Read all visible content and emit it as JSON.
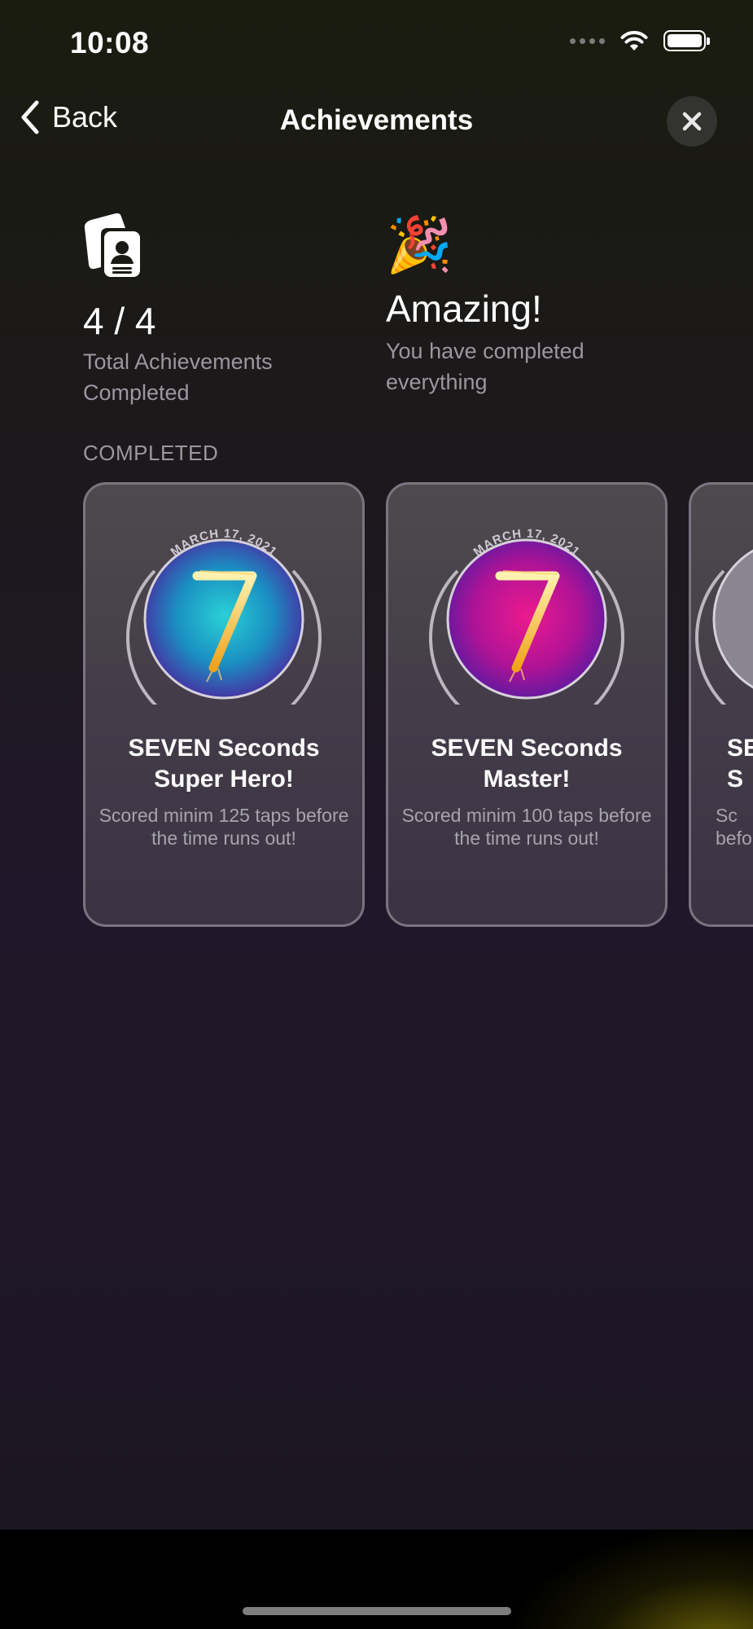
{
  "status_bar": {
    "time": "10:08"
  },
  "nav": {
    "back_label": "Back",
    "title": "Achievements"
  },
  "stats": {
    "value": "4 / 4",
    "label": "Total Achievements Completed"
  },
  "amazing": {
    "emoji": "🎉",
    "title": "Amazing!",
    "subtitle": "You have completed everything"
  },
  "section": {
    "label": "COMPLETED"
  },
  "cards": [
    {
      "date": "MARCH 17, 2021",
      "title": "SEVEN Seconds Super Hero!",
      "description": "Scored minim 125 taps before the time runs out!",
      "badge_color": "#1fb5c9"
    },
    {
      "date": "MARCH 17, 2021",
      "title": "SEVEN Seconds Master!",
      "description": "Scored minim 100 taps before the time runs out!",
      "badge_color": "#d11a8f"
    },
    {
      "date": "",
      "title": "SE\nS",
      "description": "Sc\nbefo",
      "badge_color": "#7a7a7a"
    }
  ],
  "colors": {
    "accent_text_secondary": "#9a97a0",
    "card_border": "#7b7480"
  }
}
